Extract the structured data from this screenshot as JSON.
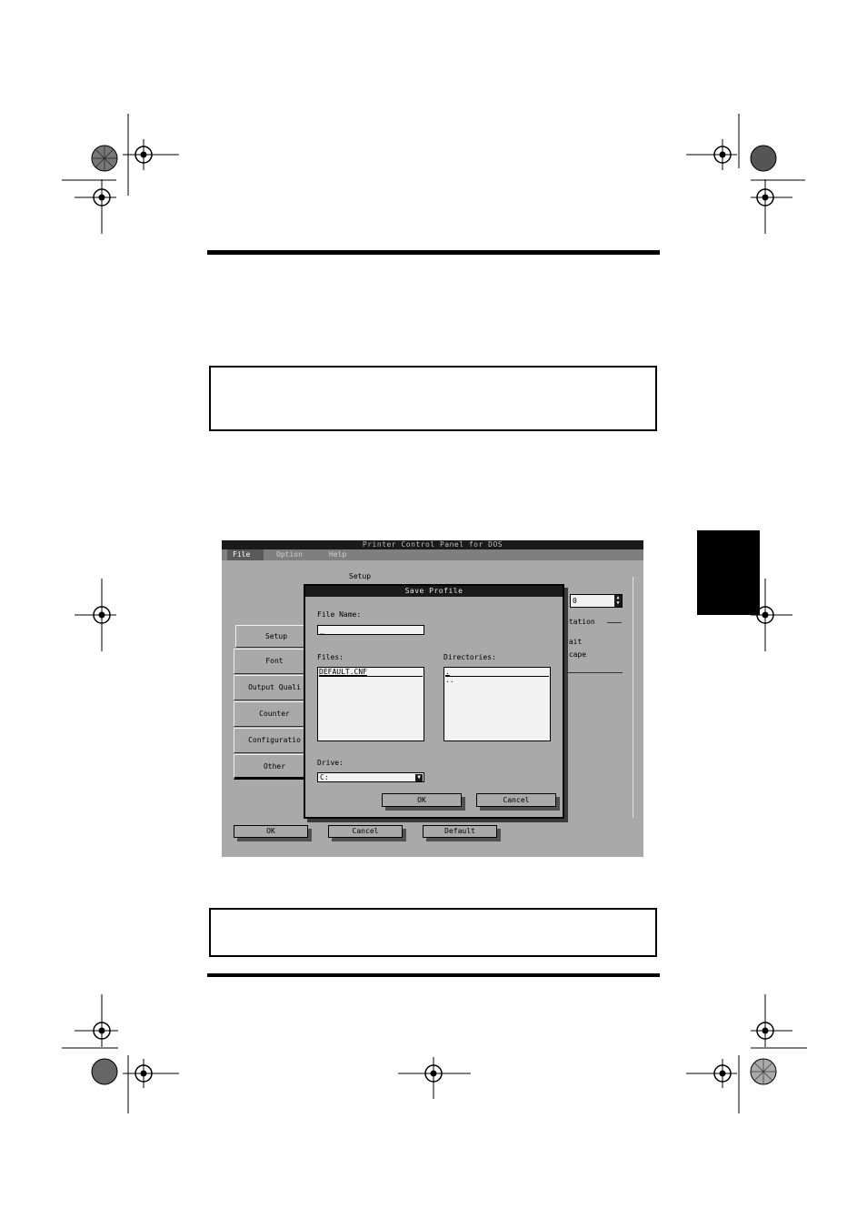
{
  "app": {
    "window_title": "Printer Control Panel for DOS",
    "menu": [
      "File",
      "Option",
      "Help"
    ],
    "active_menu": "File"
  },
  "background_panel": {
    "group_label": "Setup",
    "spinner_value": "0",
    "orientation_label": "ntation",
    "radio_1": "rait",
    "radio_2": "scape"
  },
  "tabs": [
    "Setup",
    "Font",
    "Output Quali",
    "Counter",
    "Configuratio",
    "Other"
  ],
  "bottom_buttons": {
    "ok": "OK",
    "cancel": "Cancel",
    "default": "Default"
  },
  "dialog": {
    "title": "Save Profile",
    "file_name_label": "File Name:",
    "file_name_value": "_",
    "files_label": "Files:",
    "files": [
      "DEFAULT.CNF"
    ],
    "directories_label": "Directories:",
    "directories": [
      ".",
      ".."
    ],
    "drive_label": "Drive:",
    "drive_value": "C:",
    "ok_label": "OK",
    "cancel_label": "Cancel"
  },
  "icons": [
    "registration-mark-icon",
    "starburst-target-icon",
    "dropdown-arrow-icon",
    "spinner-arrows-icon"
  ]
}
